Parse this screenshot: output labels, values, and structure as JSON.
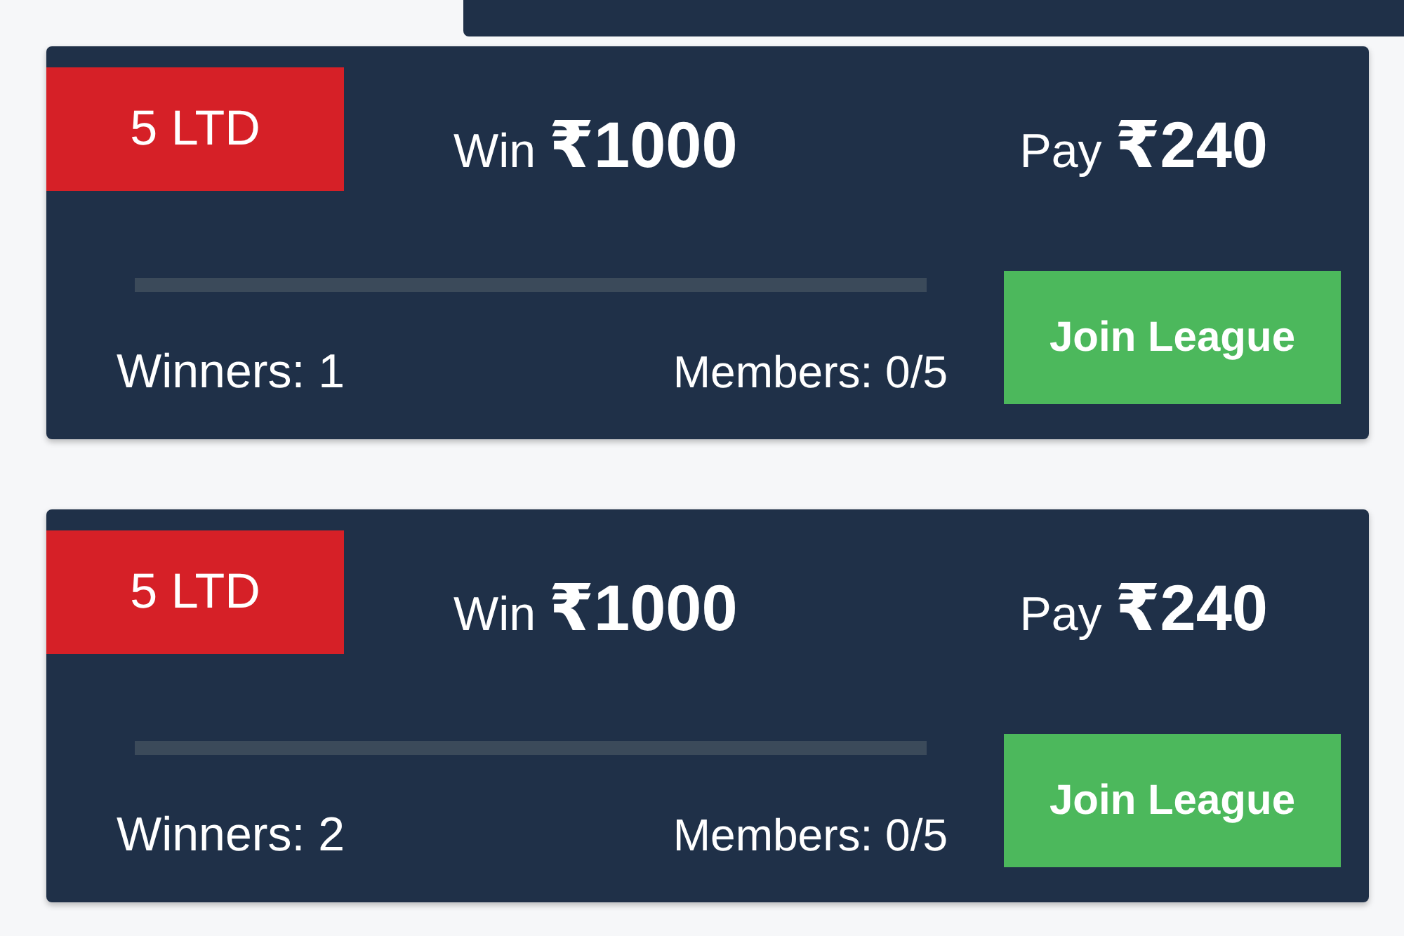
{
  "cards": [
    {
      "badge": "5 LTD",
      "prize": "Win **₹1000**",
      "fee": "Pay **₹240**",
      "level": 0,
      "winners": "Winners: 1",
      "members": "Members: 0/5",
      "button": "Join League"
    },
    {
      "badge": "5 LTD",
      "prize": "Win **₹1000**",
      "fee": "Pay **₹240**",
      "level": 0,
      "winners": "Winners: 2",
      "members": "Members: 0/5",
      "button": "Join League"
    }
  ]
}
